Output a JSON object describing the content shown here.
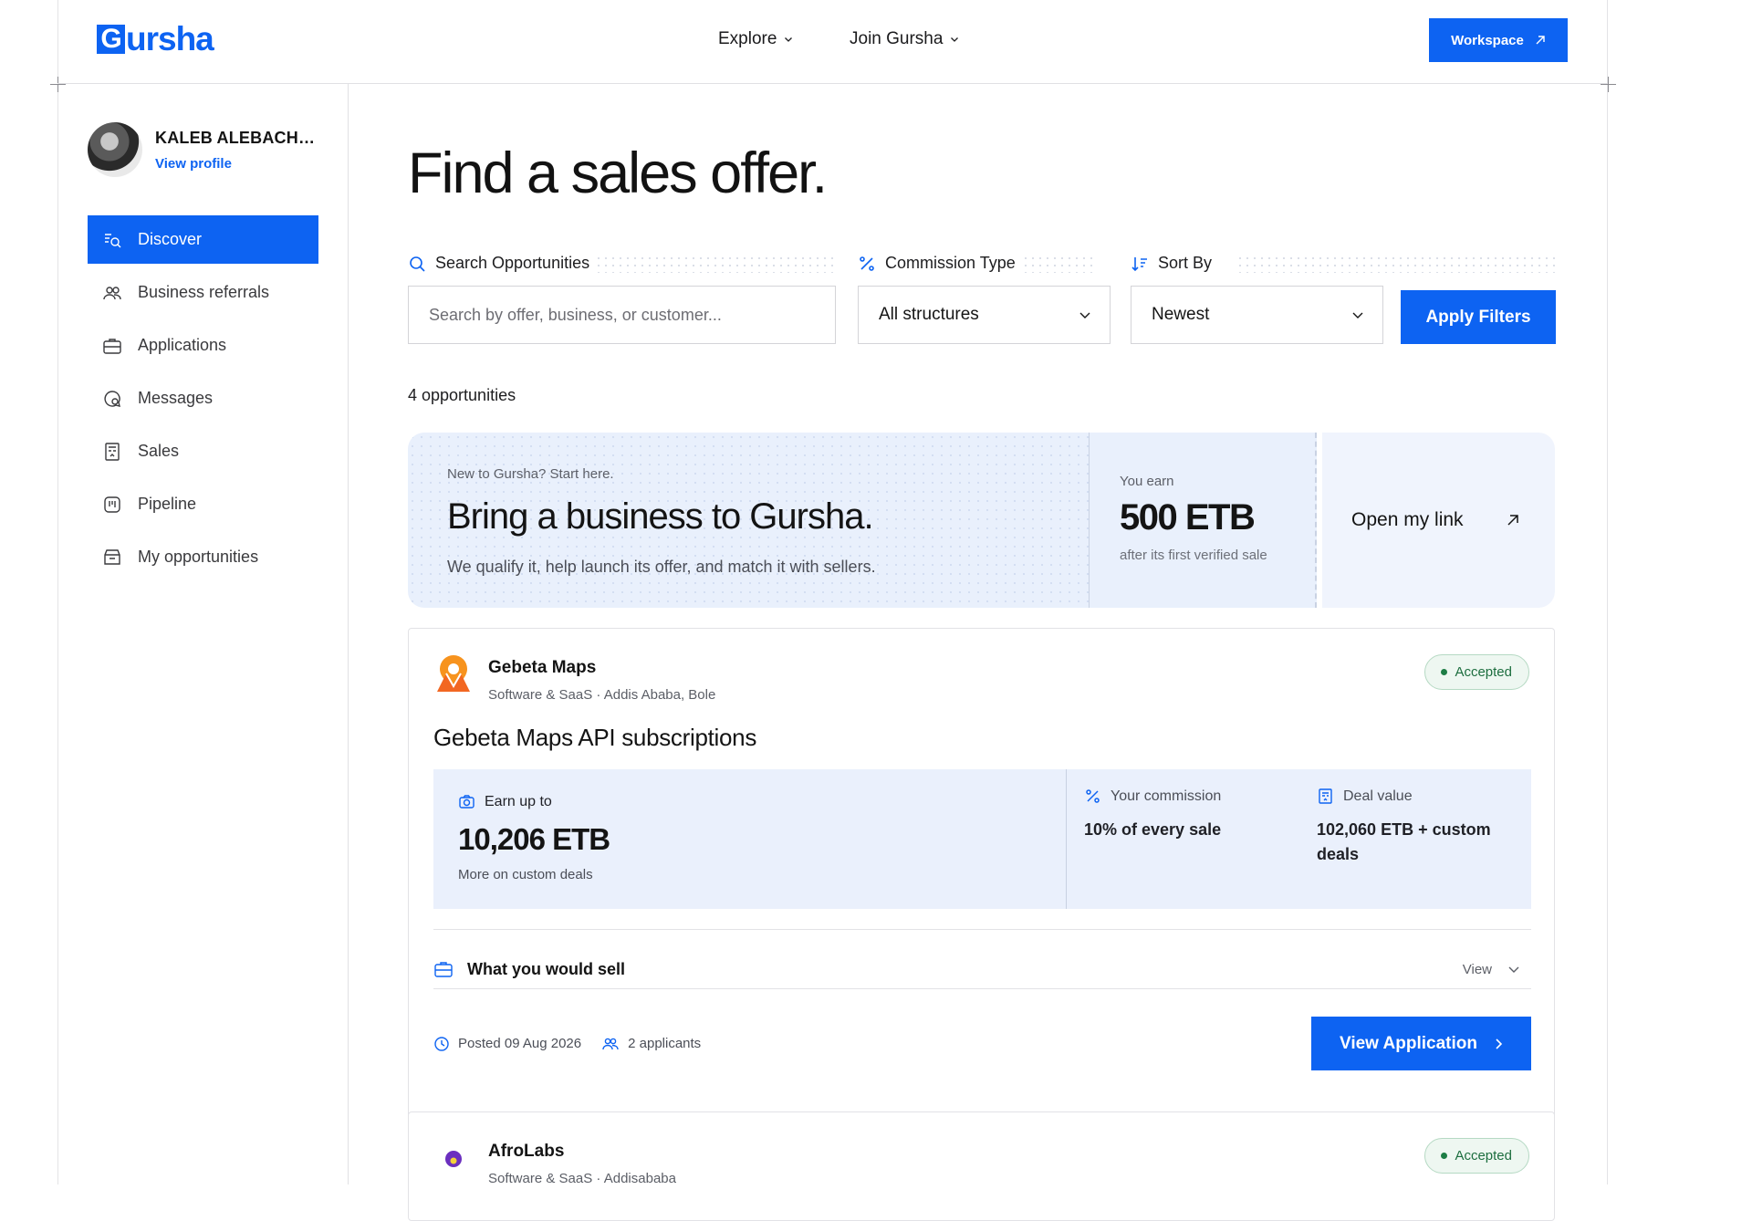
{
  "header": {
    "logo_text": "ursha",
    "logo_initial": "G",
    "nav": [
      {
        "label": "Explore"
      },
      {
        "label": "Join Gursha"
      }
    ],
    "workspace_label": "Workspace"
  },
  "sidebar": {
    "profile": {
      "name": "KALEB ALEBACHE...",
      "link": "View profile"
    },
    "items": [
      {
        "label": "Discover",
        "icon": "discover-icon",
        "active": true
      },
      {
        "label": "Business referrals",
        "icon": "users-icon"
      },
      {
        "label": "Applications",
        "icon": "briefcase-icon"
      },
      {
        "label": "Messages",
        "icon": "chat-icon"
      },
      {
        "label": "Sales",
        "icon": "receipt-icon"
      },
      {
        "label": "Pipeline",
        "icon": "kanban-icon"
      },
      {
        "label": "My opportunities",
        "icon": "store-icon"
      }
    ]
  },
  "main": {
    "title": "Find a sales offer.",
    "filters": {
      "search_label": "Search Opportunities",
      "search_placeholder": "Search by offer, business, or customer...",
      "commission_label": "Commission Type",
      "commission_value": "All structures",
      "sort_label": "Sort By",
      "sort_value": "Newest",
      "apply_label": "Apply Filters"
    },
    "count_text": "4 opportunities",
    "promo": {
      "eyebrow": "New to Gursha? Start here.",
      "title": "Bring a business to Gursha.",
      "subtitle": "We qualify it, help launch its offer, and match it with sellers.",
      "earn_eyebrow": "You earn",
      "earn_value": "500 ETB",
      "earn_sub": "after its first verified sale",
      "link_label": "Open my link"
    },
    "offers": [
      {
        "business": "Gebeta Maps",
        "meta": "Software & SaaS · Addis Ababa, Bole",
        "status": "Accepted",
        "title": "Gebeta Maps API subscriptions",
        "earn_label": "Earn up to",
        "earn_value": "10,206 ETB",
        "earn_sub": "More on custom deals",
        "commission_label": "Your commission",
        "commission_value": "10% of every sale",
        "deal_label": "Deal value",
        "deal_value": "102,060 ETB + custom deals",
        "sell_label": "What you would sell",
        "sell_action": "View",
        "posted": "Posted 09 Aug 2026",
        "applicants": "2 applicants",
        "cta": "View Application"
      },
      {
        "business": "AfroLabs",
        "meta": "Software & SaaS · Addisababa",
        "status": "Accepted"
      }
    ]
  },
  "colors": {
    "accent": "#0d63f2",
    "accepted": "#1d7d45",
    "promo_bg": "#e9f0fc"
  }
}
